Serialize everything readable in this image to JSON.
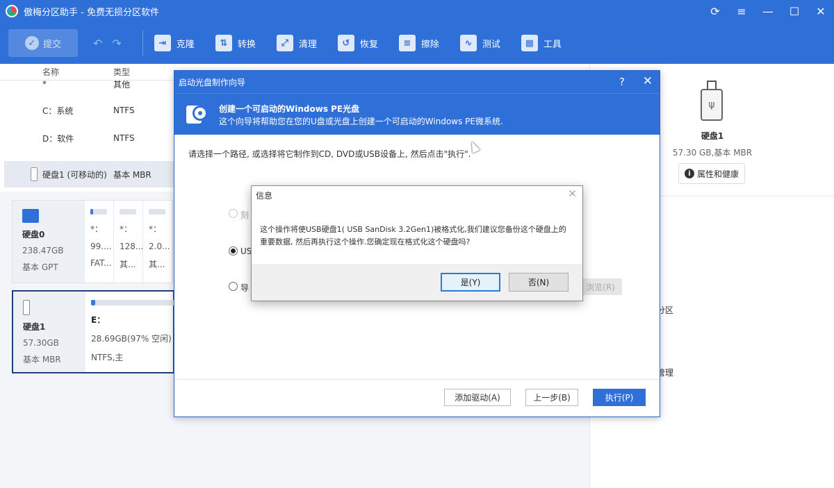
{
  "app": {
    "title": "傲梅分区助手 - 免费无损分区软件",
    "controls": [
      "⟳",
      "≡",
      "—",
      "☐",
      "✕"
    ]
  },
  "toolbar": {
    "commit": "提交",
    "tools": [
      {
        "label": "克隆",
        "icon": "clone-icon"
      },
      {
        "label": "转换",
        "icon": "convert-icon"
      },
      {
        "label": "清理",
        "icon": "clean-icon"
      },
      {
        "label": "恢复",
        "icon": "recover-icon"
      },
      {
        "label": "擦除",
        "icon": "wipe-icon"
      },
      {
        "label": "测试",
        "icon": "test-icon"
      },
      {
        "label": "工具",
        "icon": "tools-icon"
      }
    ]
  },
  "table": {
    "headers": {
      "name": "名称",
      "type": "类型"
    },
    "rows": [
      {
        "name": "*",
        "type": "其他"
      },
      {
        "name": "C：系统",
        "type": "NTFS"
      },
      {
        "name": "D：软件",
        "type": "NTFS"
      },
      {
        "name": "硬盘1 (可移动的)",
        "type": "基本 MBR"
      }
    ]
  },
  "disks": [
    {
      "name": "硬盘0",
      "size": "238.47GB",
      "style": "基本 GPT",
      "partitions": [
        {
          "label": "*：",
          "size": "99....",
          "fs": "FAT..."
        },
        {
          "label": "*：",
          "size": "128...",
          "fs": "其..."
        },
        {
          "label": "*：",
          "size": "2.0...",
          "fs": "其..."
        }
      ]
    },
    {
      "name": "硬盘1",
      "size": "57.30GB",
      "style": "基本 MBR",
      "partitions": [
        {
          "label": "E：",
          "size": "28.69GB(97% 空闲)",
          "fs": "NTFS,主"
        }
      ]
    }
  ],
  "right_panel": {
    "disk_name": "硬盘1",
    "disk_sub": "57.30 GB,基本 MBR",
    "health_button": "属性和健康",
    "op1": "分区",
    "op2": "管理"
  },
  "wizard": {
    "title": "启动光盘制作向导",
    "help": "?",
    "close": "✕",
    "heading": "创建一个可启动的Windows PE光盘",
    "subheading": "这个向导将帮助您在您的U盘或光盘上创建一个可启动的Windows PE微系统.",
    "instruction": "请选择一个路径, 或选择将它制作到CD, DVD或USB设备上, 然后点击\"执行\".",
    "option_burn": "刻",
    "option_usb": "US",
    "option_export": "导",
    "browse": "浏览(R)",
    "buttons": {
      "add_driver": "添加驱动(A)",
      "back": "上一步(B)",
      "execute": "执行(P)"
    }
  },
  "modal": {
    "title": "信息",
    "close": "✕",
    "message_line1": "这个操作将使USB硬盘1( USB SanDisk 3.2Gen1)被格式化,我们建议您备份这个硬盘上的",
    "message_line2": "重要数据, 然后再执行这个操作.您确定现在格式化这个硬盘吗?",
    "yes": "是(Y)",
    "no": "否(N)"
  }
}
